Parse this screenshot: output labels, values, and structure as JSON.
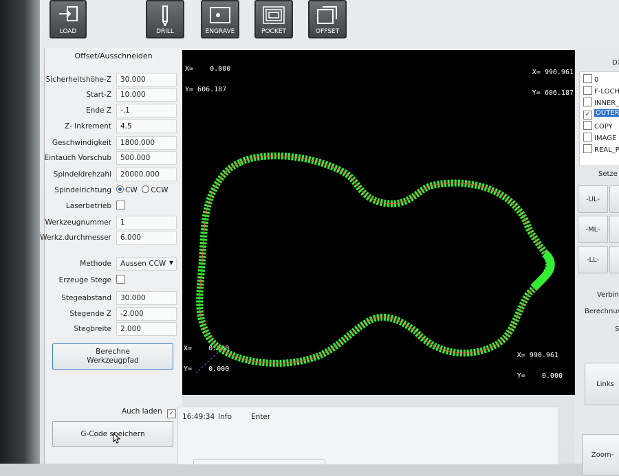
{
  "toolbar": {
    "load": "LOAD",
    "drill": "DRILL",
    "engrave": "ENGRAVE",
    "pocket": "POCKET",
    "offset": "OFFSET"
  },
  "panel": {
    "title": "Offset/Ausschneiden",
    "fields": [
      {
        "label": "Sicherheitshöhe-Z",
        "value": "30.000"
      },
      {
        "label": "Start-Z",
        "value": "10.000"
      },
      {
        "label": "Ende Z",
        "value": "-.1"
      },
      {
        "label": "Z- Inkrement",
        "value": "4.5"
      },
      {
        "label": "Geschwindigkeit",
        "value": "1800.000"
      },
      {
        "label": "Eintauch Vorschub",
        "value": "500.000"
      },
      {
        "label": "Spindeldrehzahl",
        "value": "20000.000"
      }
    ],
    "spindle_dir_label": "Spindelrichtung",
    "cw": "CW",
    "ccw": "CCW",
    "laser_label": "Laserbetrieb",
    "tool_number_label": "Werkzeugnummer",
    "tool_number": "1",
    "tool_diam_label": "Werkz.durchmesser",
    "tool_diam": "6.000",
    "method_label": "Methode",
    "method_value": "Aussen CCW",
    "tabs_label": "Erzeuge Stege",
    "tab_fields": [
      {
        "label": "Stegeabstand",
        "value": "30.000"
      },
      {
        "label": "Stegende Z",
        "value": "-2.000"
      },
      {
        "label": "Stegbreite",
        "value": "2.000"
      }
    ],
    "calc_button_line1": "Berechne",
    "calc_button_line2": "Werkzeugpfad",
    "auto_load_label": "Auch laden",
    "save_button": "G-Code speichern"
  },
  "canvas": {
    "tl_x": "X=    0.000",
    "tl_y": "Y= 606.187",
    "tr_x": "X= 990.961",
    "tr_y": "Y= 606.187",
    "bl_x": "X=    0.000",
    "bl_y": "Y=    0.000",
    "br_x": "X= 990.961",
    "br_y": "Y=    0.000",
    "path_color": "#33ee33",
    "arrow_color": "#ff4444"
  },
  "layers": {
    "title": "DX",
    "items": [
      {
        "name": "0",
        "checked": false
      },
      {
        "name": "F-LOCH",
        "checked": false
      },
      {
        "name": "INNER_",
        "checked": false
      },
      {
        "name": "OUTER",
        "checked": true
      },
      {
        "name": "COPY",
        "checked": false
      },
      {
        "name": "IMAGE",
        "checked": false
      },
      {
        "name": "REAL_P",
        "checked": false
      }
    ]
  },
  "right": {
    "set_label": "Setze",
    "ul": "-UL-",
    "ml": "-ML-",
    "ll": "-LL-",
    "connect": "Verbin",
    "calc": "Berechnun",
    "s": "S",
    "links": "Links",
    "zoom": "Zoom-"
  },
  "log": {
    "time": "16:49:34",
    "level": "Info",
    "message": "Enter"
  }
}
